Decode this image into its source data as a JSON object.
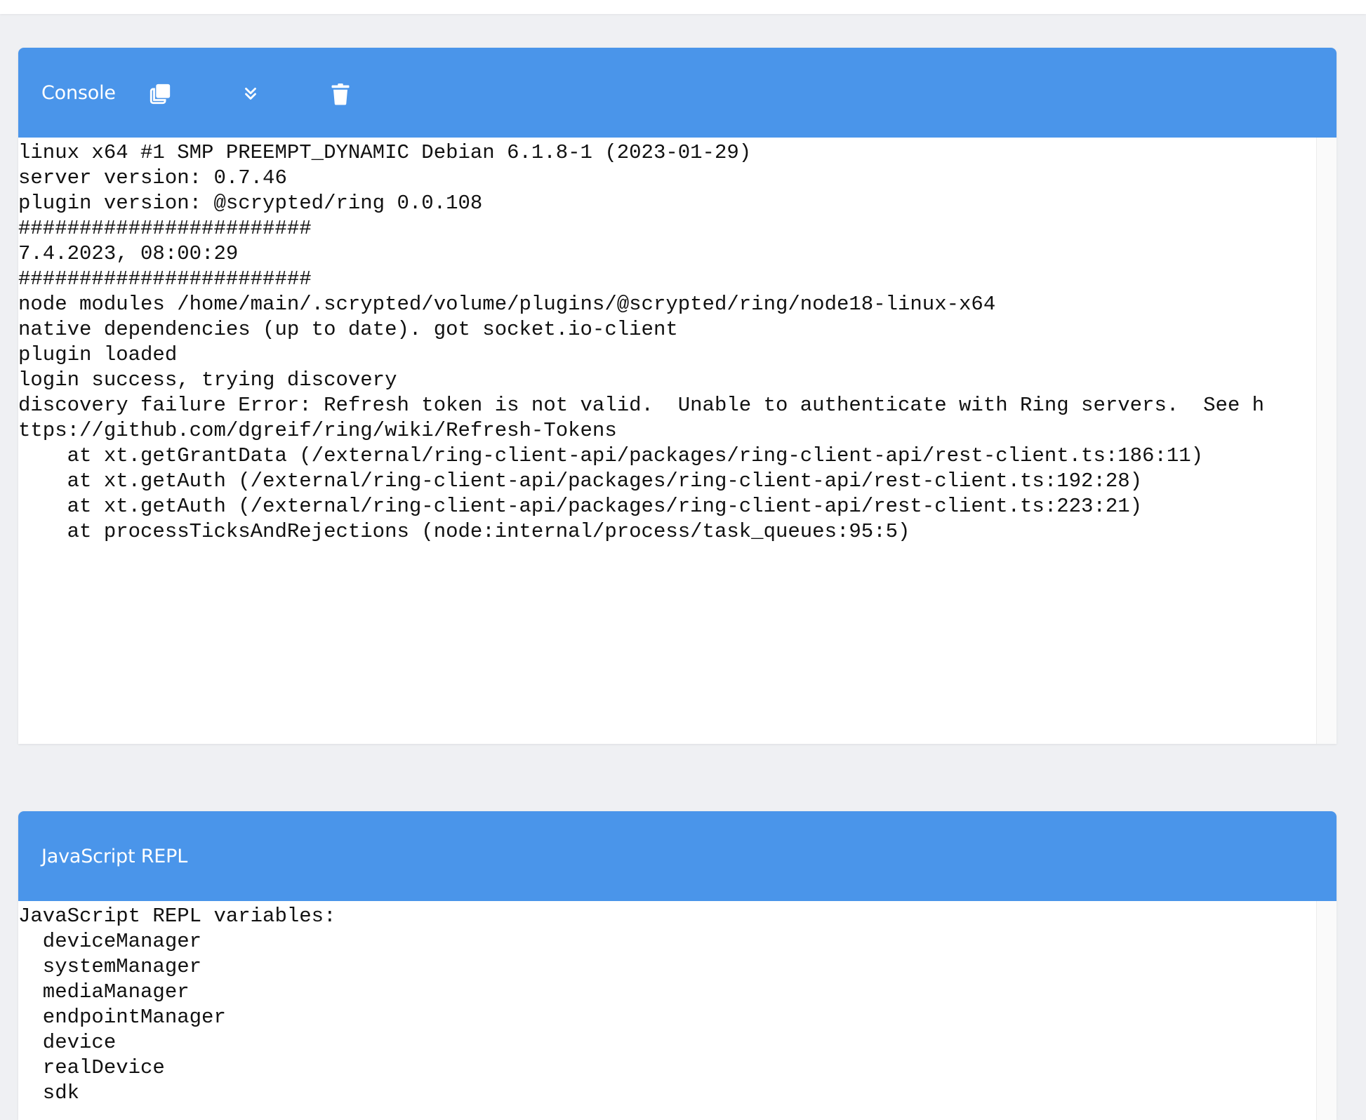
{
  "console": {
    "title": "Console",
    "icons": {
      "copy": "copy-icon",
      "scroll": "scroll-to-bottom-icon",
      "clear": "trash-icon"
    },
    "lines": [
      "linux x64 #1 SMP PREEMPT_DYNAMIC Debian 6.1.8-1 (2023-01-29)",
      "server version: 0.7.46",
      "plugin version: @scrypted/ring 0.0.108",
      "########################",
      "7.4.2023, 08:00:29",
      "########################",
      "node modules /home/main/.scrypted/volume/plugins/@scrypted/ring/node18-linux-x64",
      "native dependencies (up to date). got socket.io-client",
      "plugin loaded",
      "login success, trying discovery",
      "discovery failure Error: Refresh token is not valid.  Unable to authenticate with Ring servers.  See h",
      "ttps://github.com/dgreif/ring/wiki/Refresh-Tokens",
      "    at xt.getGrantData (/external/ring-client-api/packages/ring-client-api/rest-client.ts:186:11)",
      "    at xt.getAuth (/external/ring-client-api/packages/ring-client-api/rest-client.ts:192:28)",
      "    at xt.getAuth (/external/ring-client-api/packages/ring-client-api/rest-client.ts:223:21)",
      "    at processTicksAndRejections (node:internal/process/task_queues:95:5)"
    ]
  },
  "repl": {
    "title": "JavaScript REPL",
    "lines": [
      "JavaScript REPL variables:",
      "  deviceManager",
      "  systemManager",
      "  mediaManager",
      "  endpointManager",
      "  device",
      "  realDevice",
      "  sdk"
    ]
  },
  "colors": {
    "header": "#4a95ea",
    "background": "#eff0f3",
    "terminal_text": "#111111"
  }
}
